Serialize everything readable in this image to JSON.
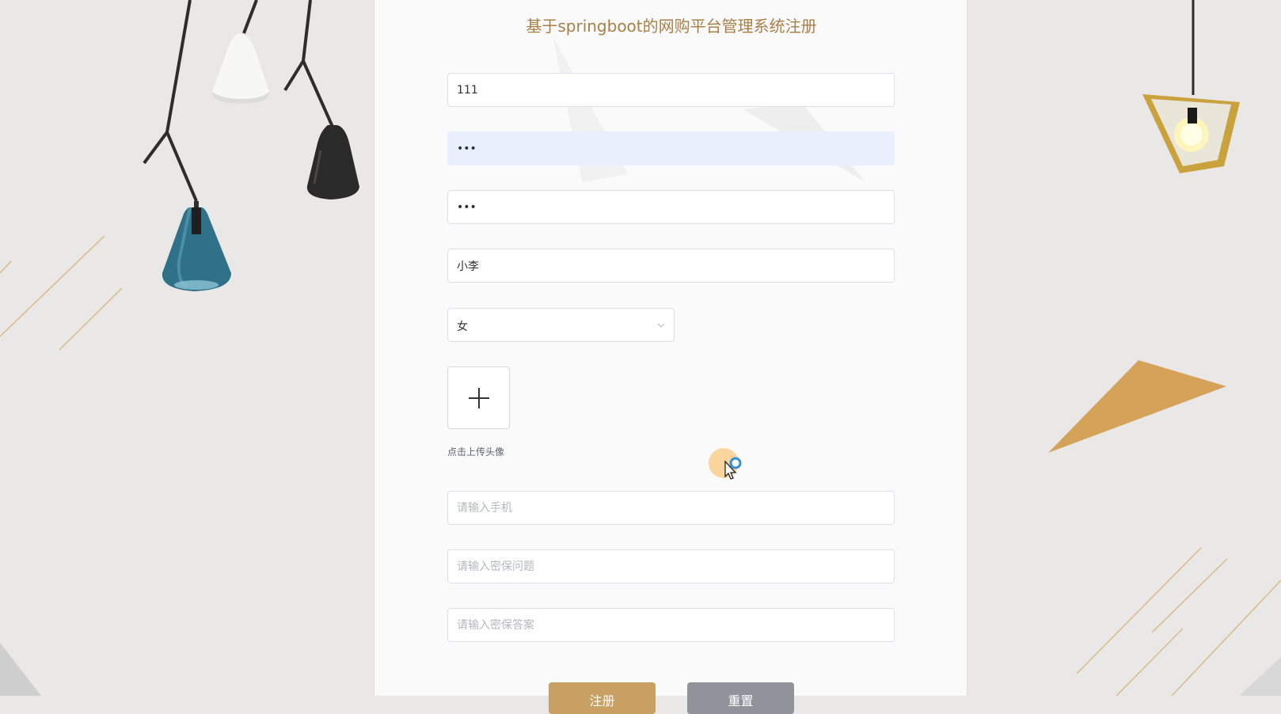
{
  "page": {
    "title": "基于springboot的网购平台管理系统注册"
  },
  "form": {
    "account": {
      "value": "111",
      "placeholder": ""
    },
    "password": {
      "value": "123",
      "placeholder": ""
    },
    "confirm_password": {
      "value": "123",
      "placeholder": ""
    },
    "name": {
      "value": "小李",
      "placeholder": ""
    },
    "gender": {
      "selected": "女"
    },
    "avatar": {
      "hint": "点击上传头像"
    },
    "phone": {
      "value": "",
      "placeholder": "请输入手机"
    },
    "security_question": {
      "value": "",
      "placeholder": "请输入密保问题"
    },
    "security_answer": {
      "value": "",
      "placeholder": "请输入密保答案"
    }
  },
  "buttons": {
    "register": "注册",
    "reset": "重置"
  },
  "icons": {
    "upload": "plus-icon",
    "select_arrow": "chevron-down-icon",
    "cursor": "mouse-pointer-icon"
  },
  "colors": {
    "title": "#a97f46",
    "register_button": "#c9a063",
    "reset_button": "#909399",
    "autofill_bg": "#e8f0fe",
    "accent_triangle": "#d4a259"
  }
}
